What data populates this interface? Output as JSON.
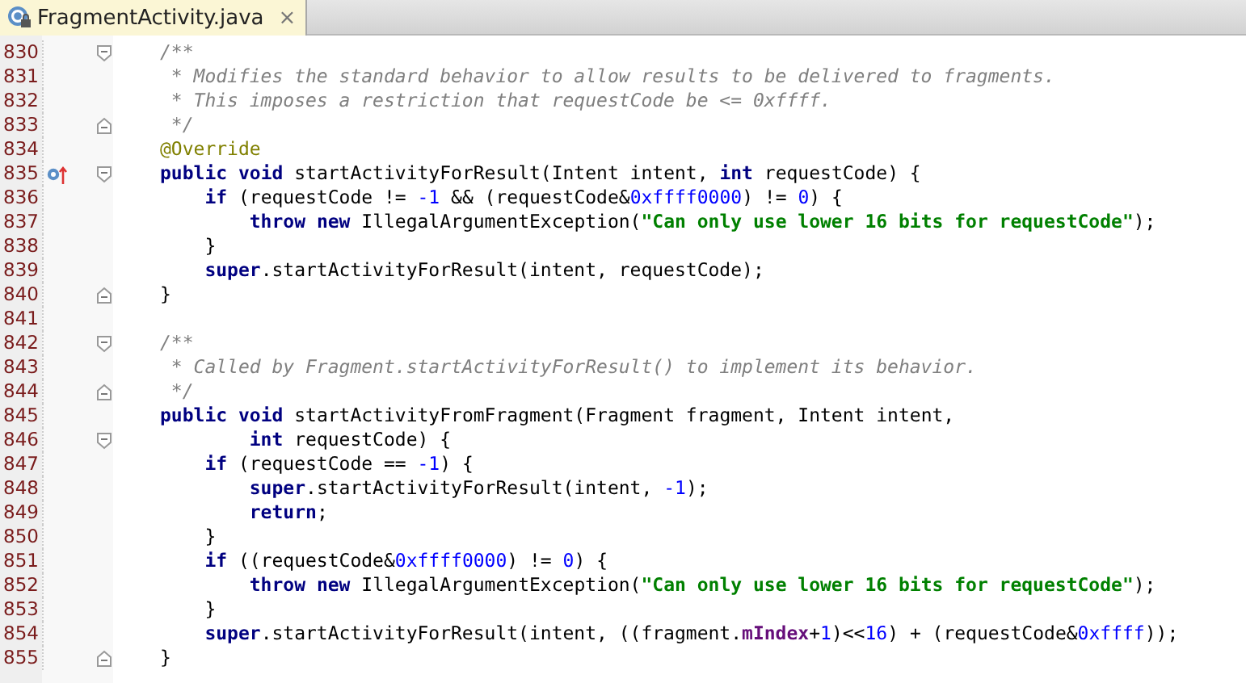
{
  "tabs": [
    {
      "label": "FragmentActivity.java",
      "selected": true,
      "close": "×"
    }
  ],
  "lines": [
    {
      "number": "830",
      "fold_start": true,
      "tokens": [
        {
          "kind": "comment",
          "text": "/**"
        }
      ]
    },
    {
      "number": "831",
      "tokens": [
        {
          "kind": "comment",
          "text": " * Modifies the standard behavior to allow results to be delivered to fragments."
        }
      ]
    },
    {
      "number": "832",
      "tokens": [
        {
          "kind": "comment",
          "text": " * This imposes a restriction that requestCode be <= 0xffff."
        }
      ]
    },
    {
      "number": "833",
      "fold_end": true,
      "tokens": [
        {
          "kind": "comment",
          "text": " */"
        }
      ]
    },
    {
      "number": "834",
      "tokens": [
        {
          "kind": "annotation",
          "text": "@Override"
        }
      ]
    },
    {
      "number": "835",
      "fold_start": true,
      "overrides": true,
      "tokens": [
        {
          "kind": "keyword",
          "text": "public"
        },
        {
          "kind": "keyword",
          "text": " void"
        },
        {
          "kind": "plain",
          "text": " startActivityForResult(Intent intent, "
        },
        {
          "kind": "keyword",
          "text": "int"
        },
        {
          "kind": "plain",
          "text": " requestCode) {"
        }
      ]
    },
    {
      "number": "836",
      "tokens": [
        {
          "kind": "keyword",
          "text": "    if"
        },
        {
          "kind": "plain",
          "text": " (requestCode != "
        },
        {
          "kind": "number",
          "text": "-1"
        },
        {
          "kind": "plain",
          "text": " && (requestCode&"
        },
        {
          "kind": "number",
          "text": "0xffff0000"
        },
        {
          "kind": "plain",
          "text": ") != "
        },
        {
          "kind": "number",
          "text": "0"
        },
        {
          "kind": "plain",
          "text": ") {"
        }
      ]
    },
    {
      "number": "837",
      "tokens": [
        {
          "kind": "keyword",
          "text": "        throw"
        },
        {
          "kind": "keyword",
          "text": " new"
        },
        {
          "kind": "plain",
          "text": " IllegalArgumentException("
        },
        {
          "kind": "string",
          "text": "\"Can only use lower 16 bits for requestCode\""
        },
        {
          "kind": "plain",
          "text": ");"
        }
      ]
    },
    {
      "number": "838",
      "tokens": [
        {
          "kind": "plain",
          "text": "    }"
        }
      ]
    },
    {
      "number": "839",
      "tokens": [
        {
          "kind": "keyword",
          "text": "    super"
        },
        {
          "kind": "plain",
          "text": ".startActivityForResult(intent, requestCode);"
        }
      ]
    },
    {
      "number": "840",
      "fold_end": true,
      "tokens": [
        {
          "kind": "plain",
          "text": "}"
        }
      ]
    },
    {
      "number": "841"
    },
    {
      "number": "842",
      "fold_start": true,
      "tokens": [
        {
          "kind": "comment",
          "text": "/**"
        }
      ]
    },
    {
      "number": "843",
      "tokens": [
        {
          "kind": "comment",
          "text": " * Called by Fragment.startActivityForResult() to implement its behavior."
        }
      ]
    },
    {
      "number": "844",
      "fold_end": true,
      "tokens": [
        {
          "kind": "comment",
          "text": " */"
        }
      ]
    },
    {
      "number": "845",
      "tokens": [
        {
          "kind": "keyword",
          "text": "public"
        },
        {
          "kind": "keyword",
          "text": " void"
        },
        {
          "kind": "plain",
          "text": " startActivityFromFragment(Fragment fragment, Intent intent,"
        }
      ]
    },
    {
      "number": "846",
      "fold_start": true,
      "tokens": [
        {
          "kind": "keyword",
          "text": "        int"
        },
        {
          "kind": "plain",
          "text": " requestCode) {"
        }
      ]
    },
    {
      "number": "847",
      "tokens": [
        {
          "kind": "keyword",
          "text": "    if"
        },
        {
          "kind": "plain",
          "text": " (requestCode == "
        },
        {
          "kind": "number",
          "text": "-1"
        },
        {
          "kind": "plain",
          "text": ") {"
        }
      ]
    },
    {
      "number": "848",
      "tokens": [
        {
          "kind": "keyword",
          "text": "        super"
        },
        {
          "kind": "plain",
          "text": ".startActivityForResult(intent, "
        },
        {
          "kind": "number",
          "text": "-1"
        },
        {
          "kind": "plain",
          "text": ");"
        }
      ]
    },
    {
      "number": "849",
      "tokens": [
        {
          "kind": "keyword",
          "text": "        return"
        },
        {
          "kind": "plain",
          "text": ";"
        }
      ]
    },
    {
      "number": "850",
      "tokens": [
        {
          "kind": "plain",
          "text": "    }"
        }
      ]
    },
    {
      "number": "851",
      "tokens": [
        {
          "kind": "keyword",
          "text": "    if"
        },
        {
          "kind": "plain",
          "text": " ((requestCode&"
        },
        {
          "kind": "number",
          "text": "0xffff0000"
        },
        {
          "kind": "plain",
          "text": ") != "
        },
        {
          "kind": "number",
          "text": "0"
        },
        {
          "kind": "plain",
          "text": ") {"
        }
      ]
    },
    {
      "number": "852",
      "tokens": [
        {
          "kind": "keyword",
          "text": "        throw"
        },
        {
          "kind": "keyword",
          "text": " new"
        },
        {
          "kind": "plain",
          "text": " IllegalArgumentException("
        },
        {
          "kind": "string",
          "text": "\"Can only use lower 16 bits for requestCode\""
        },
        {
          "kind": "plain",
          "text": ");"
        }
      ]
    },
    {
      "number": "853",
      "tokens": [
        {
          "kind": "plain",
          "text": "    }"
        }
      ]
    },
    {
      "number": "854",
      "tokens": [
        {
          "kind": "keyword",
          "text": "    super"
        },
        {
          "kind": "plain",
          "text": ".startActivityForResult(intent, ((fragment."
        },
        {
          "kind": "field",
          "text": "mIndex"
        },
        {
          "kind": "plain",
          "text": "+"
        },
        {
          "kind": "number",
          "text": "1"
        },
        {
          "kind": "plain",
          "text": ")<<"
        },
        {
          "kind": "number",
          "text": "16"
        },
        {
          "kind": "plain",
          "text": ") + (requestCode&"
        },
        {
          "kind": "number",
          "text": "0xffff"
        },
        {
          "kind": "plain",
          "text": "));"
        }
      ]
    },
    {
      "number": "855",
      "fold_end": true,
      "tokens": [
        {
          "kind": "plain",
          "text": "}"
        }
      ]
    }
  ]
}
